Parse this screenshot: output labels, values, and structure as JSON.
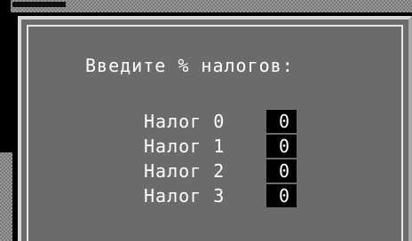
{
  "dialog": {
    "prompt": "Введите % налогов:",
    "taxes": [
      {
        "label": "Налог 0",
        "value": "0"
      },
      {
        "label": "Налог 1",
        "value": "0"
      },
      {
        "label": "Налог 2",
        "value": "0"
      },
      {
        "label": "Налог 3",
        "value": "0"
      }
    ]
  }
}
